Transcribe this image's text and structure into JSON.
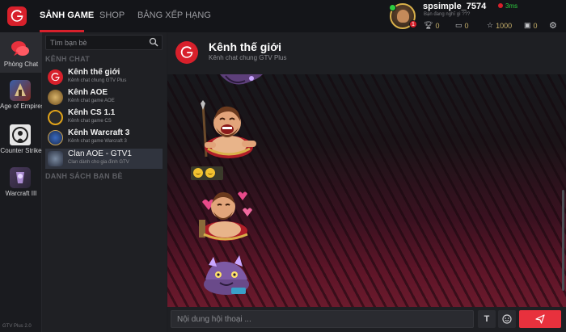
{
  "topbar": {
    "nav": [
      {
        "label": "SẢNH GAME",
        "active": true
      },
      {
        "label": "SHOP",
        "active": false
      },
      {
        "label": "BẢNG XẾP HẠNG",
        "active": false
      }
    ],
    "user": {
      "name": "spsimple_7574",
      "status": "Bạn đang nghĩ gì ???",
      "ping": "3ms",
      "notification_count": "1",
      "stats": [
        {
          "icon": "trophy-icon",
          "value": "0"
        },
        {
          "icon": "chat-icon",
          "value": "0"
        },
        {
          "icon": "star-icon",
          "value": "1000"
        },
        {
          "icon": "chest-icon",
          "value": "0"
        }
      ]
    }
  },
  "dock": [
    {
      "label": "Phòng Chat",
      "icon": "chat-bubble-icon",
      "active": true
    },
    {
      "label": "Age of Empires",
      "icon": "age-of-empires-icon",
      "active": false
    },
    {
      "label": "Counter Strike",
      "icon": "counter-strike-icon",
      "active": false
    },
    {
      "label": "Warcraft III",
      "icon": "warcraft-icon",
      "active": false
    }
  ],
  "version": "GTV Plus 2.0",
  "sidebar": {
    "search_placeholder": "Tìm bạn bè",
    "channels_heading": "KÊNH CHAT",
    "friends_heading": "DANH SÁCH BẠN BÈ",
    "channels": [
      {
        "name": "Kênh thế giới",
        "sub": "Kênh chat chung GTV Plus",
        "icon": "gtv-logo-icon",
        "selected": false
      },
      {
        "name": "Kênh AOE",
        "sub": "Kênh chat game AOE",
        "icon": "aoe-helmet-icon",
        "selected": false
      },
      {
        "name": "Kênh CS 1.1",
        "sub": "Kênh chat game CS",
        "icon": "cs-logo-icon",
        "selected": false
      },
      {
        "name": "Kênh Warcraft 3",
        "sub": "Kênh chat game Warcraft 3",
        "icon": "warcraft-logo-icon",
        "selected": false
      },
      {
        "name": "Clan AOE - GTV1",
        "sub": "Clan dành cho gia đình GTV",
        "icon": "clan-shield-icon",
        "selected": true
      }
    ]
  },
  "chat": {
    "title": "Kênh thế giới",
    "subtitle": "Kênh chat chung GTV Plus",
    "stickers": [
      "purple-creature-sticker",
      "warrior-laughing-sticker",
      "grinning-face-emoji",
      "warrior-hearts-sticker",
      "purple-creature-sticker"
    ],
    "input_placeholder": "Nội dung hội thoại ...",
    "text_tool": "T"
  },
  "colors": {
    "accent": "#d8202b",
    "send": "#e8313d",
    "online": "#2ecc40"
  }
}
